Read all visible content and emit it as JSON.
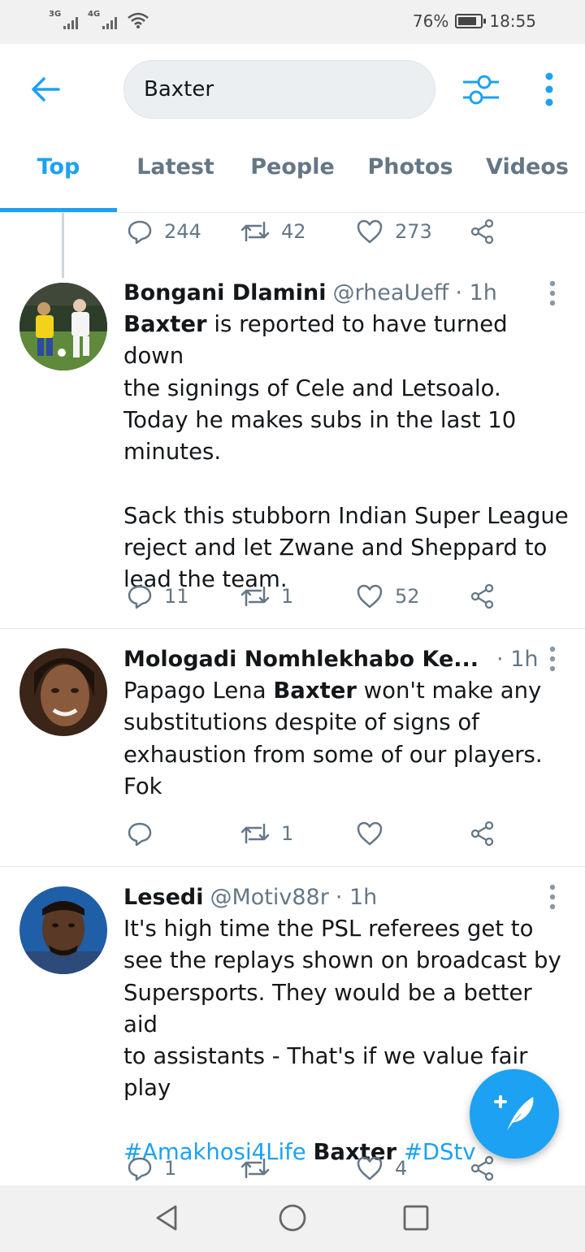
{
  "status_bar": {
    "signal_1": "3G",
    "signal_2": "4G",
    "battery": "76%",
    "time": "18:55"
  },
  "header": {
    "search_value": "Baxter",
    "icons": {
      "back": "arrow-left-icon",
      "filter": "sliders-icon",
      "more": "vertical-dots-icon"
    }
  },
  "tabs": [
    {
      "label": "Top",
      "active": true
    },
    {
      "label": "Latest",
      "active": false
    },
    {
      "label": "People",
      "active": false
    },
    {
      "label": "Photos",
      "active": false
    },
    {
      "label": "Videos",
      "active": false
    }
  ],
  "previous_tweet": {
    "replies": "244",
    "retweets": "42",
    "likes": "273"
  },
  "tweets": [
    {
      "name": "Bongani Dlamini",
      "handle": "@rheaUeff",
      "time": "· 1h",
      "body_lines": [
        [
          "Baxter",
          " is reported to have turned down"
        ],
        "the signings of Cele and Letsoalo.",
        "Today he makes subs in the last 10",
        "minutes.",
        "",
        "Sack this stubborn Indian Super League",
        "reject and let Zwane and Sheppard to",
        "lead the team."
      ],
      "replies": "11",
      "retweets": "1",
      "likes": "52"
    },
    {
      "name": "Mologadi Nomhlekhabo Ke...",
      "handle": "",
      "time": "· 1h",
      "body_lines": [
        [
          "Papago Lena ",
          "Baxter",
          " won't make any"
        ],
        "substitutions despite of signs of",
        "exhaustion from some of our players.",
        "Fok"
      ],
      "replies": "",
      "retweets": "1",
      "likes": ""
    },
    {
      "name": "Lesedi",
      "handle": "@Motiv88r",
      "time": "· 1h",
      "body_lines": [
        "It's high time the PSL referees get to",
        "see the replays shown on broadcast by",
        "Supersports. They would be a better aid",
        "to assistants - That's if we value fair",
        "play"
      ],
      "hashtag_1": "#Amakhosi4Life",
      "hashtag_bold": "Baxter",
      "hashtag_2": "#DStv",
      "replies": "1",
      "retweets": "",
      "likes": "4"
    }
  ],
  "colors": {
    "accent": "#1da1f2",
    "text": "#14171a",
    "muted": "#657786",
    "divider": "#e1e8ed"
  },
  "fab": {
    "icon": "compose-feather-plus-icon"
  },
  "nav": {
    "icons": [
      "back-triangle-icon",
      "home-circle-icon",
      "recents-square-icon"
    ]
  }
}
